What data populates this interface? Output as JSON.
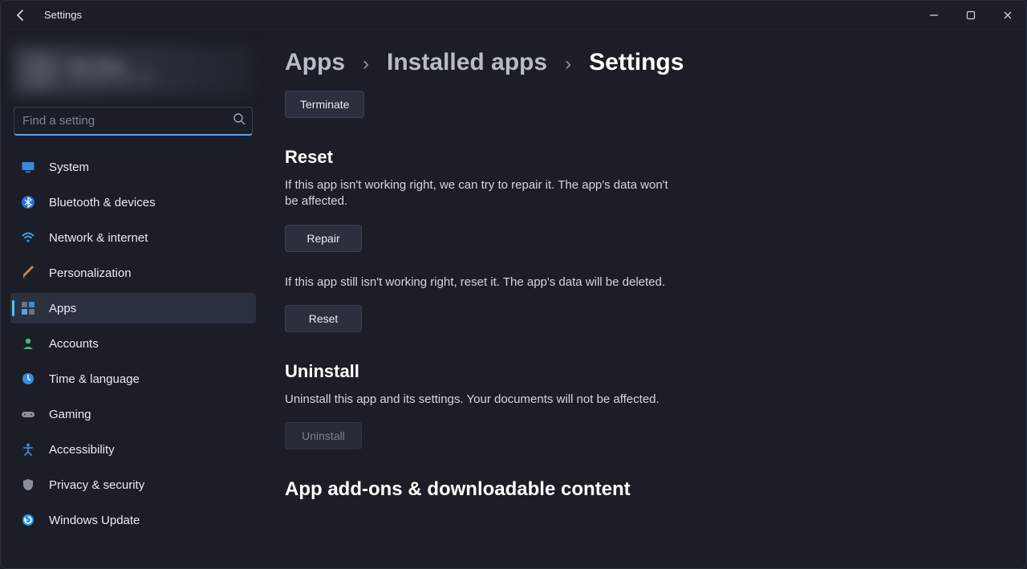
{
  "window": {
    "title": "Settings"
  },
  "search": {
    "placeholder": "Find a setting"
  },
  "sidebar": {
    "items": [
      {
        "label": "System"
      },
      {
        "label": "Bluetooth & devices"
      },
      {
        "label": "Network & internet"
      },
      {
        "label": "Personalization"
      },
      {
        "label": "Apps"
      },
      {
        "label": "Accounts"
      },
      {
        "label": "Time & language"
      },
      {
        "label": "Gaming"
      },
      {
        "label": "Accessibility"
      },
      {
        "label": "Privacy & security"
      },
      {
        "label": "Windows Update"
      }
    ]
  },
  "breadcrumb": {
    "items": [
      "Apps",
      "Installed apps",
      "Settings"
    ]
  },
  "main": {
    "terminate": {
      "label": "Terminate"
    },
    "reset": {
      "heading": "Reset",
      "repair_desc": "If this app isn't working right, we can try to repair it. The app's data won't be affected.",
      "repair_label": "Repair",
      "reset_desc": "If this app still isn't working right, reset it. The app's data will be deleted.",
      "reset_label": "Reset"
    },
    "uninstall": {
      "heading": "Uninstall",
      "desc": "Uninstall this app and its settings. Your documents will not be affected.",
      "label": "Uninstall"
    },
    "addons": {
      "heading": "App add-ons & downloadable content"
    }
  }
}
